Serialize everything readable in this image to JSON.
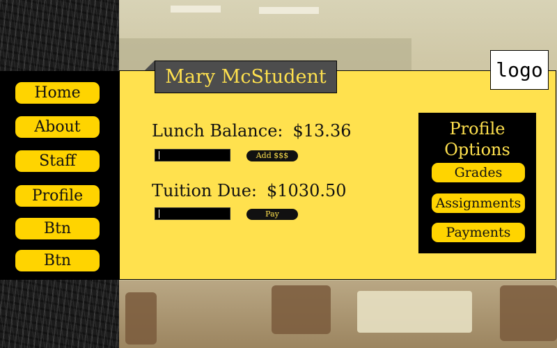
{
  "nav": {
    "items": [
      {
        "label": "Home"
      },
      {
        "label": "About"
      },
      {
        "label": "Staff"
      },
      {
        "label": "Profile"
      },
      {
        "label": "Btn"
      },
      {
        "label": "Btn"
      }
    ]
  },
  "header": {
    "student_name": "Mary McStudent",
    "logo_text": "logo"
  },
  "lunch": {
    "label": "Lunch Balance:",
    "amount": "$13.36",
    "input_value": "",
    "button_label": "Add $$$"
  },
  "tuition": {
    "label": "Tuition Due:",
    "amount": "$1030.50",
    "input_value": "",
    "button_label": "Pay"
  },
  "profile_options": {
    "title_line1": "Profile",
    "title_line2": "Options",
    "items": [
      {
        "label": "Grades"
      },
      {
        "label": "Assignments"
      },
      {
        "label": "Payments"
      }
    ]
  },
  "colors": {
    "accent": "#ffe14e",
    "button": "#ffd400",
    "dark": "#000000",
    "name_tab": "#4d4d4d"
  }
}
